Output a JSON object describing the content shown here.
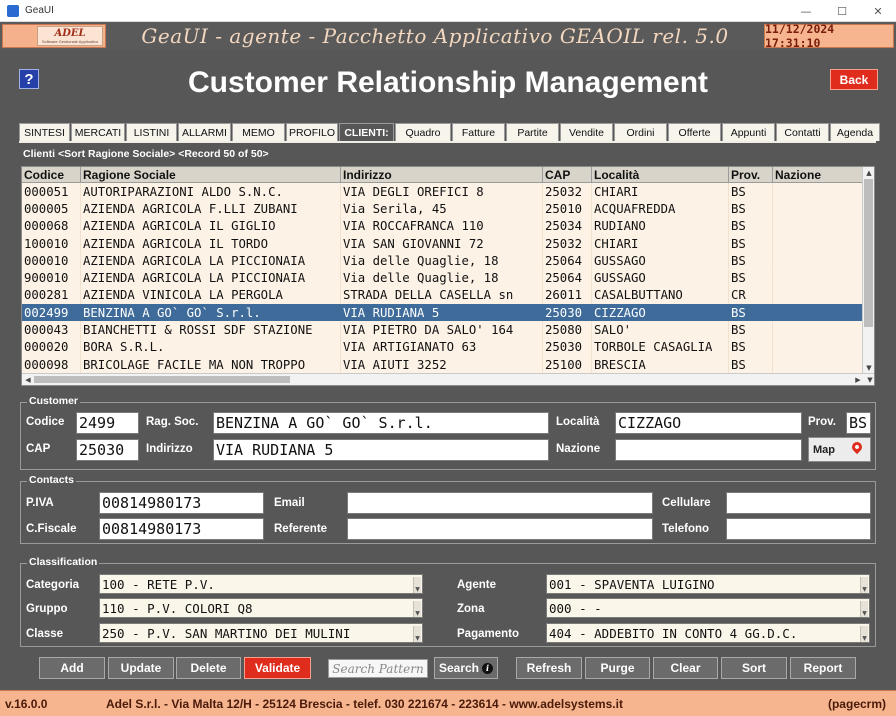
{
  "window": {
    "title": "GeaUI",
    "controls": [
      "—",
      "☐",
      "✕"
    ]
  },
  "banner": {
    "logo_text": "ADEL",
    "logo_subtext": "Software Gestionale Applicativo",
    "title": "GeaUI - agente - Pacchetto Applicativo GEAOIL rel. 5.0",
    "datetime": "11/12/2024 17:31:10"
  },
  "page": {
    "help_label": "?",
    "heading": "Customer Relationship Management",
    "back_label": "Back",
    "record_info": "Clienti <Sort Ragione Sociale> <Record 50 of 50>"
  },
  "tabs": [
    "SINTESI",
    "MERCATI",
    "LISTINI",
    "ALLARMI",
    "MEMO",
    "PROFILO",
    "CLIENTI:",
    "Quadro",
    "Fatture",
    "Partite",
    "Vendite",
    "Ordini",
    "Offerte",
    "Appunti",
    "Contatti",
    "Agenda"
  ],
  "active_tab": "CLIENTI:",
  "grid": {
    "columns": [
      "Codice",
      "Ragione Sociale",
      "Indirizzo",
      "CAP",
      "Località",
      "Prov.",
      "Nazione"
    ],
    "selected_row": 7,
    "rows": [
      [
        "000051",
        "AUTORIPARAZIONI ALDO S.N.C.",
        "VIA DEGLI OREFICI 8",
        "25032",
        "CHIARI",
        "BS",
        ""
      ],
      [
        "000005",
        "AZIENDA AGRICOLA F.LLI ZUBANI",
        "Via Serila, 45",
        "25010",
        "ACQUAFREDDA",
        "BS",
        ""
      ],
      [
        "000068",
        "AZIENDA AGRICOLA IL GIGLIO",
        "VIA ROCCAFRANCA 110",
        "25034",
        "RUDIANO",
        "BS",
        ""
      ],
      [
        "100010",
        "AZIENDA AGRICOLA IL TORDO",
        "VIA SAN GIOVANNI 72",
        "25032",
        "CHIARI",
        "BS",
        ""
      ],
      [
        "000010",
        "AZIENDA AGRICOLA LA PICCIONAIA",
        "Via delle Quaglie, 18",
        "25064",
        "GUSSAGO",
        "BS",
        ""
      ],
      [
        "900010",
        "AZIENDA AGRICOLA LA PICCIONAIA",
        "Via delle Quaglie, 18",
        "25064",
        "GUSSAGO",
        "BS",
        ""
      ],
      [
        "000281",
        "AZIENDA VINICOLA LA PERGOLA",
        "STRADA DELLA CASELLA sn",
        "26011",
        "CASALBUTTANO",
        "CR",
        ""
      ],
      [
        "002499",
        "BENZINA A GO` GO` S.r.l.",
        "VIA RUDIANA 5",
        "25030",
        "CIZZAGO",
        "BS",
        ""
      ],
      [
        "000043",
        "BIANCHETTI & ROSSI SDF STAZIONE",
        "VIA PIETRO DA SALO' 164",
        "25080",
        "SALO'",
        "BS",
        ""
      ],
      [
        "000020",
        "BORA S.R.L.",
        "VIA ARTIGIANATO 63",
        "25030",
        "TORBOLE CASAGLIA",
        "BS",
        ""
      ],
      [
        "000098",
        "BRICOLAGE FACILE MA NON TROPPO",
        "VIA AIUTI 3252",
        "25100",
        "BRESCIA",
        "BS",
        ""
      ]
    ]
  },
  "customer": {
    "legend": "Customer",
    "labels": {
      "codice": "Codice",
      "ragsoc": "Rag. Soc.",
      "localita": "Località",
      "prov": "Prov.",
      "cap": "CAP",
      "indirizzo": "Indirizzo",
      "nazione": "Nazione",
      "map": "Map"
    },
    "values": {
      "codice": "2499",
      "ragsoc": "BENZINA A GO` GO` S.r.l.",
      "localita": "CIZZAGO",
      "prov": "BS",
      "cap": "25030",
      "indirizzo": "VIA RUDIANA 5",
      "nazione": ""
    }
  },
  "contacts": {
    "legend": "Contacts",
    "labels": {
      "piva": "P.IVA",
      "email": "Email",
      "cellulare": "Cellulare",
      "cfiscale": "C.Fiscale",
      "referente": "Referente",
      "telefono": "Telefono"
    },
    "values": {
      "piva": "00814980173",
      "email": "",
      "cellulare": "",
      "cfiscale": "00814980173",
      "referente": "",
      "telefono": ""
    }
  },
  "classification": {
    "legend": "Classification",
    "labels": {
      "categoria": "Categoria",
      "gruppo": "Gruppo",
      "classe": "Classe",
      "agente": "Agente",
      "zona": "Zona",
      "pagamento": "Pagamento"
    },
    "values": {
      "categoria": "100 - RETE P.V.",
      "gruppo": "110 - P.V. COLORI Q8",
      "classe": "250 - P.V. SAN MARTINO DEI MULINI",
      "agente": "001 - SPAVENTA LUIGINO",
      "zona": "000 - -",
      "pagamento": "404 - ADDEBITO IN CONTO 4 GG.D.C."
    }
  },
  "buttons": {
    "add": "Add",
    "update": "Update",
    "delete": "Delete",
    "validate": "Validate",
    "search_placeholder": "Search Pattern",
    "search": "Search",
    "search_info": "i",
    "refresh": "Refresh",
    "purge": "Purge",
    "clear": "Clear",
    "sort": "Sort",
    "report": "Report"
  },
  "statusbar": {
    "version": "v.16.0.0",
    "company": "Adel S.r.l. - Via Malta 12/H - 25124 Brescia - telef. 030 221674 - 223614 - www.adelsystems.it",
    "page": "(pagecrm)"
  },
  "colors": {
    "accent_red": "#e02c1c",
    "panel_gray": "#575757",
    "salmon": "#f6b58e",
    "selected_row": "#3e6b9a"
  }
}
